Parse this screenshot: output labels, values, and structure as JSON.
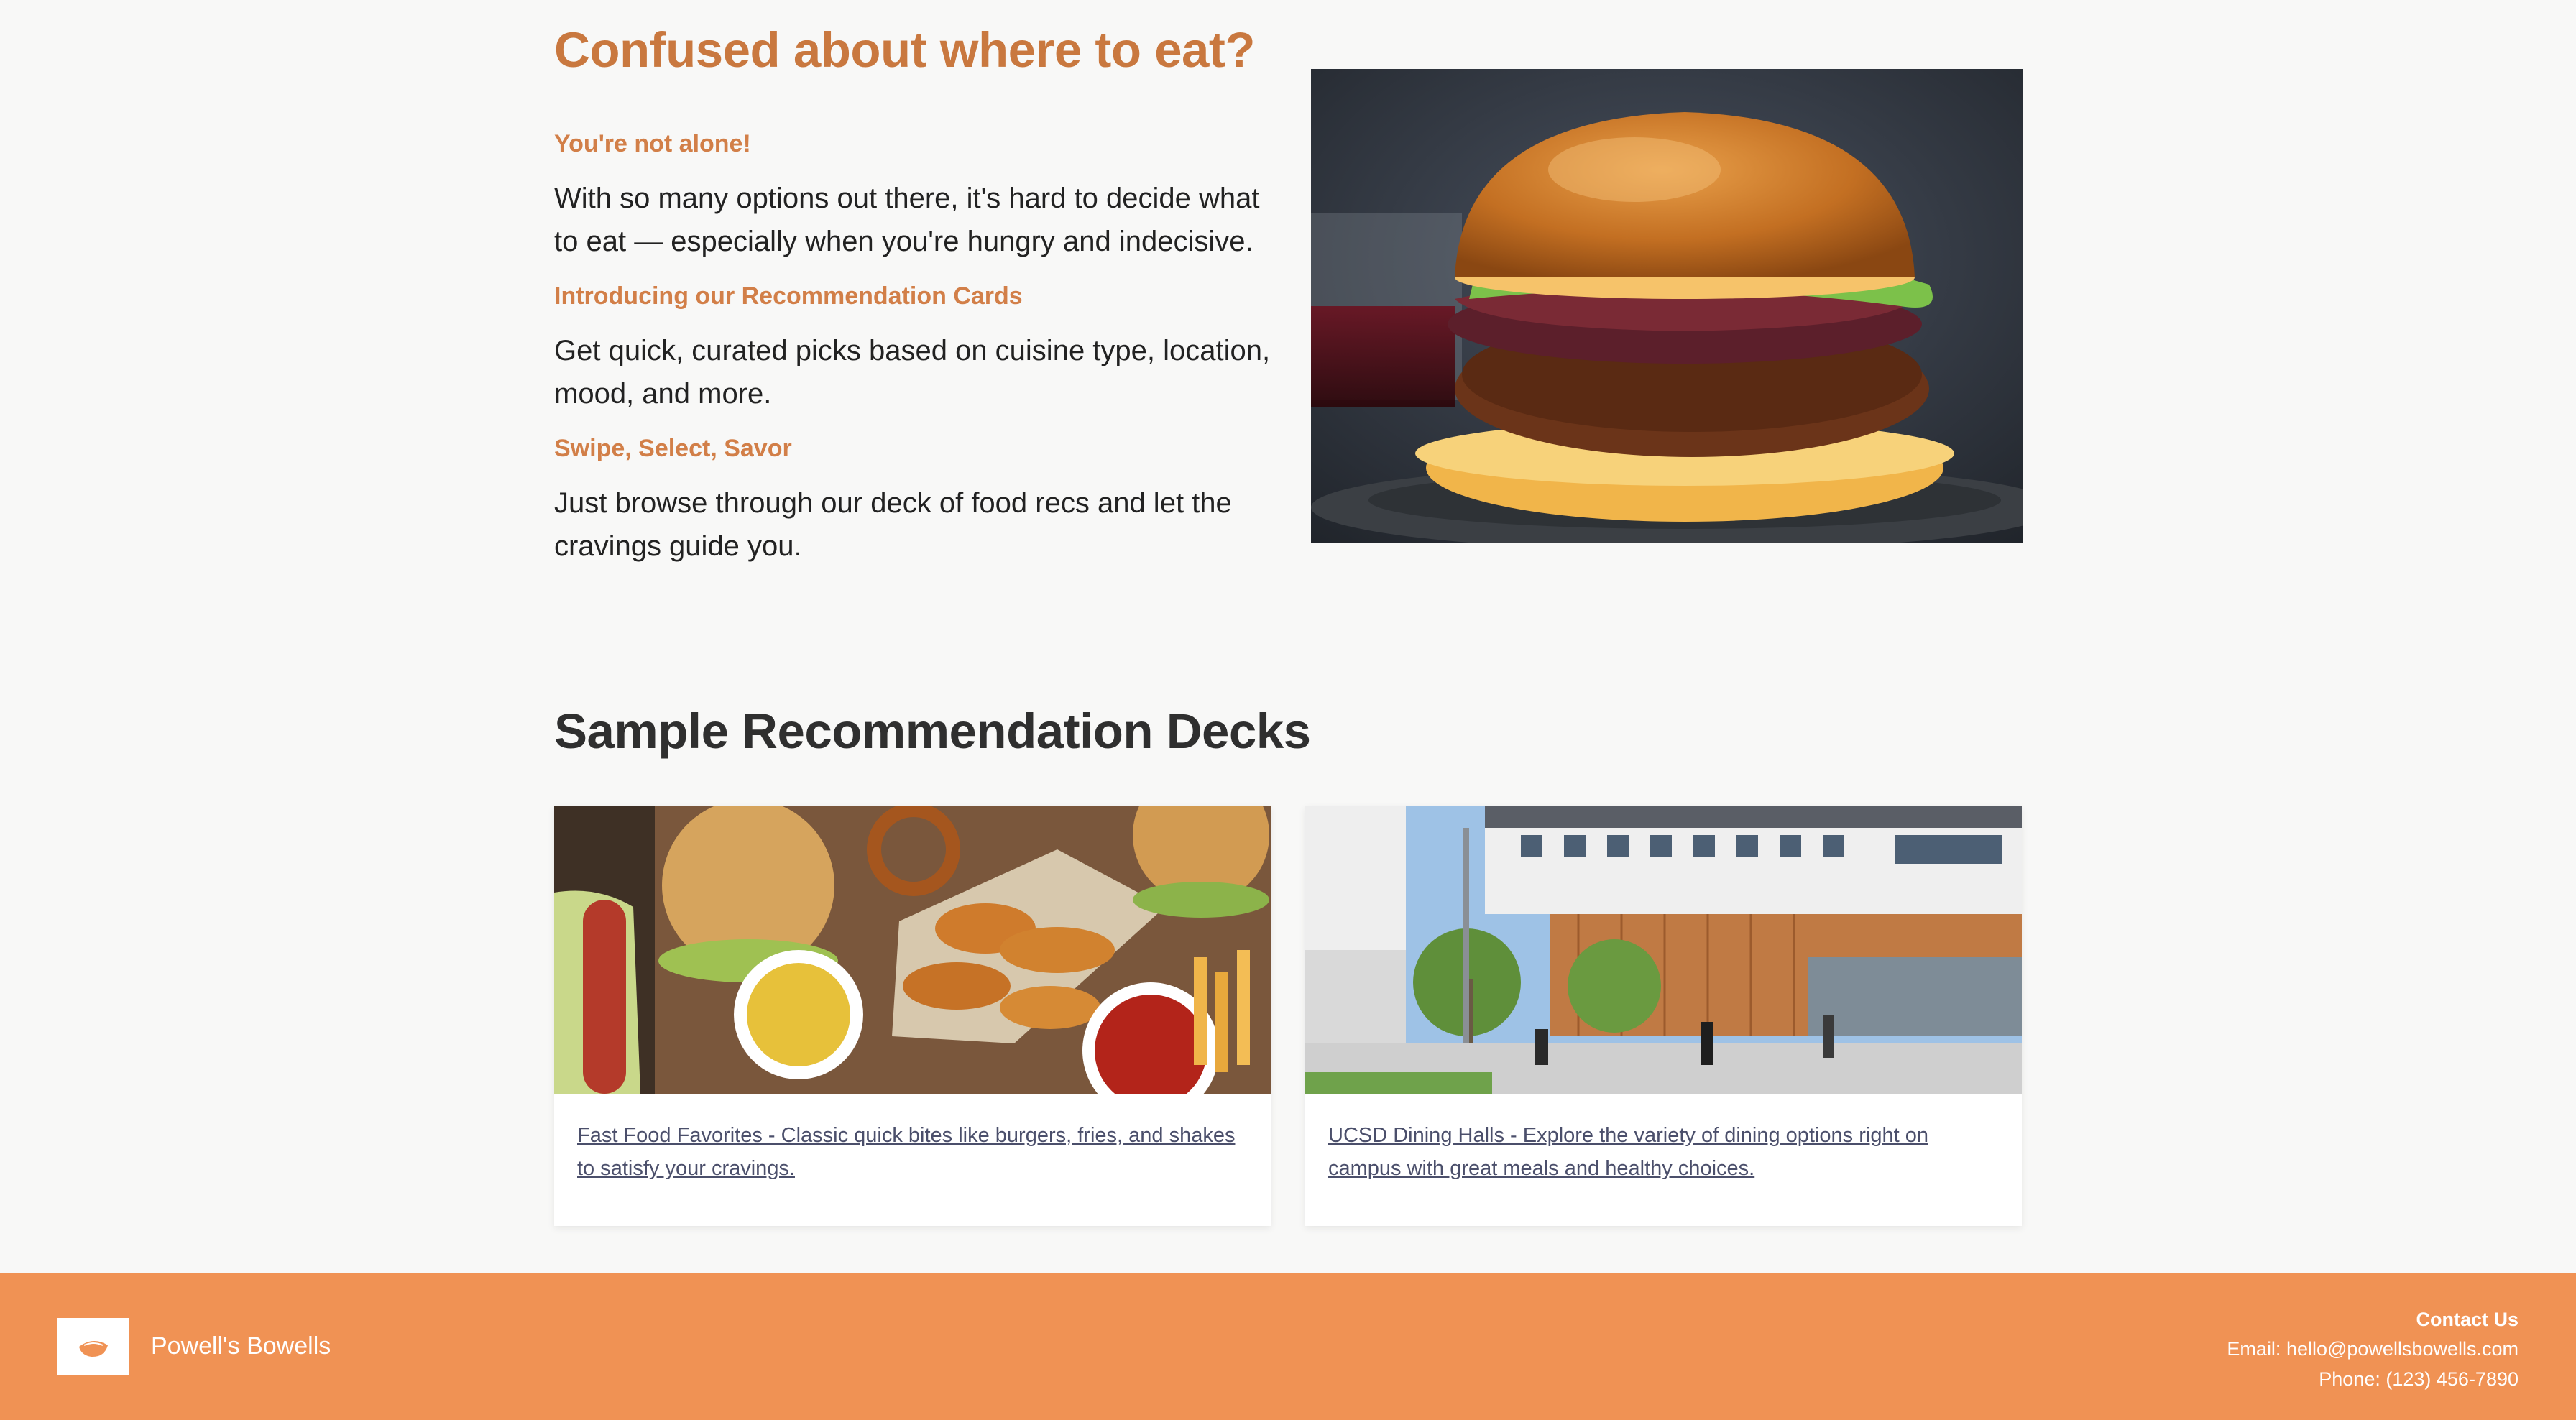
{
  "intro": {
    "title": "Confused about where to eat?",
    "sections": [
      {
        "heading": "You're not alone!",
        "text": "With so many options out there, it's hard to decide what to eat — especially when you're hungry and indecisive."
      },
      {
        "heading": "Introducing our Recommendation Cards",
        "text": "Get quick, curated picks based on cuisine type, location, mood, and more."
      },
      {
        "heading": "Swipe, Select, Savor",
        "text": "Just browse through our deck of food recs and let the cravings guide you."
      }
    ]
  },
  "decks": {
    "title": "Sample Recommendation Decks",
    "cards": [
      {
        "link": "Fast Food Favorites - Classic quick bites like burgers, fries, and shakes to satisfy your cravings."
      },
      {
        "link": "UCSD Dining Halls - Explore the variety of dining options right on campus with great meals and healthy choices."
      }
    ]
  },
  "footer": {
    "brand": "Powell's Bowells",
    "contact_title": "Contact Us",
    "email": "Email: hello@powellsbowells.com",
    "phone": "Phone: (123) 456-7890"
  },
  "colors": {
    "accent": "#c9783f",
    "footer_bg": "#f09254",
    "page_bg": "#f8f8f7"
  }
}
